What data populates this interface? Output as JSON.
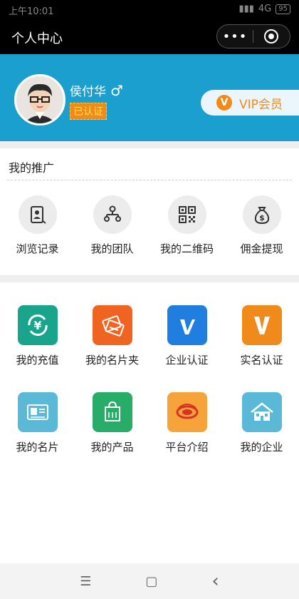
{
  "status": {
    "time": "上午10:01",
    "network": "4G",
    "battery": "95"
  },
  "navbar": {
    "title": "个人中心",
    "more": "•••"
  },
  "profile": {
    "name": "侯付华",
    "gender_symbol": "♂",
    "verified": "已认证",
    "vip_label": "VIP会员",
    "vip_badge": "V"
  },
  "promo": {
    "title": "我的推广",
    "items": [
      {
        "label": "浏览记录",
        "icon": "browse-history-icon"
      },
      {
        "label": "我的团队",
        "icon": "team-icon"
      },
      {
        "label": "我的二维码",
        "icon": "qrcode-icon"
      },
      {
        "label": "佣金提现",
        "icon": "money-bag-icon"
      }
    ]
  },
  "grid": {
    "row1": [
      {
        "label": "我的充值",
        "icon": "recharge-icon",
        "color": "#19a58b"
      },
      {
        "label": "我的名片夹",
        "icon": "card-holder-icon",
        "color": "#f06422"
      },
      {
        "label": "企业认证",
        "icon": "enterprise-verify-icon",
        "color": "#1f7ee0"
      },
      {
        "label": "实名认证",
        "icon": "realname-verify-icon",
        "color": "#f08a1b"
      }
    ],
    "row2": [
      {
        "label": "我的名片",
        "icon": "business-card-icon",
        "color": "#5bb9d8"
      },
      {
        "label": "我的产品",
        "icon": "product-icon",
        "color": "#27ad68"
      },
      {
        "label": "平台介绍",
        "icon": "platform-intro-icon",
        "color": "#f6a43a"
      },
      {
        "label": "我的企业",
        "icon": "company-icon",
        "color": "#5bb9d8"
      }
    ]
  },
  "system_nav": {
    "menu": "☰",
    "home": "▢",
    "back": "‹"
  }
}
